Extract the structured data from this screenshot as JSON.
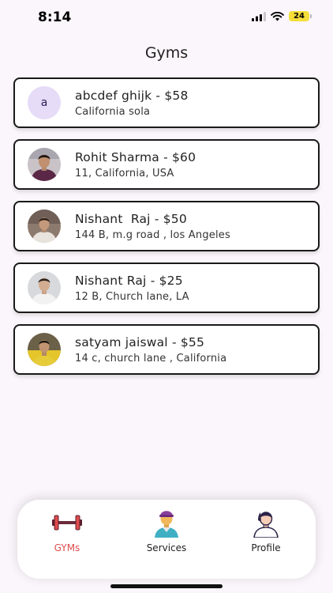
{
  "status_bar": {
    "time": "8:14",
    "battery": "24"
  },
  "header": {
    "title": "Gyms"
  },
  "gyms": [
    {
      "avatar_letter": "a",
      "title": "abcdef ghijk - $58",
      "address": "California sola",
      "avatar_icon": "letter-avatar"
    },
    {
      "title": "Rohit Sharma - $60",
      "address": "11, California, USA",
      "avatar_icon": "profile-photo"
    },
    {
      "title": "Nishant  Raj - $50",
      "address": "144 B, m.g road , los Angeles",
      "avatar_icon": "profile-photo"
    },
    {
      "title": "Nishant Raj - $25",
      "address": "12 B, Church lane, LA",
      "avatar_icon": "profile-photo"
    },
    {
      "title": "satyam jaiswal - $55",
      "address": "14 c, church lane , California",
      "avatar_icon": "profile-photo"
    }
  ],
  "bottom_nav": {
    "items": [
      {
        "label": "GYMs",
        "icon": "dumbbell-icon",
        "active": true
      },
      {
        "label": "Services",
        "icon": "trainer-icon",
        "active": false
      },
      {
        "label": "Profile",
        "icon": "user-profile-icon",
        "active": false
      }
    ]
  },
  "colors": {
    "background": "#fbf6fb",
    "card_border": "#1a1a1a",
    "active_nav": "#e04c4c",
    "letter_avatar_bg": "#e6dcf7",
    "battery": "#f5de3a"
  }
}
